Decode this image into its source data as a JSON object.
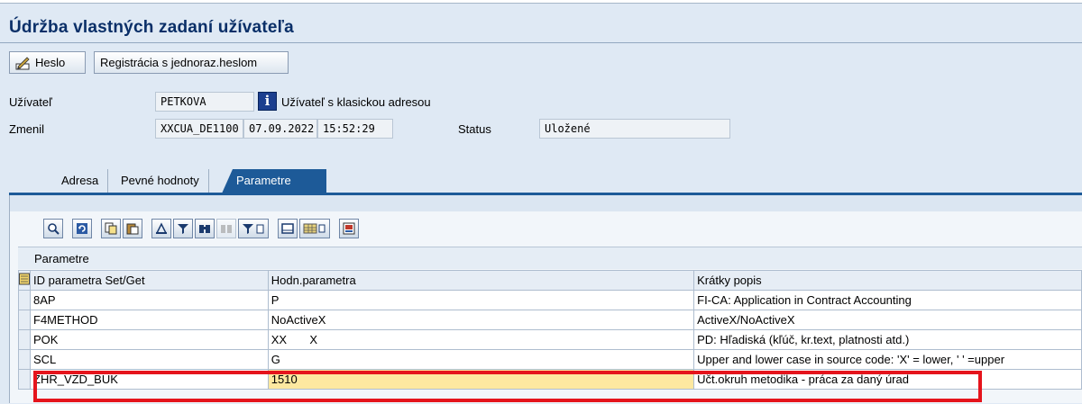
{
  "page": {
    "title": "Údržba vlastných zadaní užívateľa"
  },
  "toolbar": {
    "password_label": "Heslo",
    "one_time_label": "Registrácia s jednoraz.heslom"
  },
  "header_fields": {
    "user_label": "Užívateľ",
    "user_value": "PETKOVA",
    "user_type_text": "Užívateľ s klasickou adresou",
    "changed_label": "Zmenil",
    "changed_by": "XXCUA_DE1100",
    "changed_date": "07.09.2022",
    "changed_time": "15:52:29",
    "status_label": "Status",
    "status_value": "Uložené"
  },
  "tabs": [
    {
      "label": "Adresa",
      "active": false
    },
    {
      "label": "Pevné hodnoty",
      "active": false
    },
    {
      "label": "Parametre",
      "active": true
    }
  ],
  "grid": {
    "caption": "Parametre",
    "columns": [
      "ID parametra Set/Get",
      "Hodn.parametra",
      "Krátky popis"
    ],
    "rows": [
      {
        "id": "8AP",
        "value": "P",
        "desc": "FI-CA: Application in Contract Accounting"
      },
      {
        "id": "F4METHOD",
        "value": "NoActiveX",
        "desc": "ActiveX/NoActiveX"
      },
      {
        "id": "POK",
        "value": "XX       X",
        "desc": "PD: Hľadiská (kľúč, kr.text, platnosti atd.)"
      },
      {
        "id": "SCL",
        "value": "G",
        "desc": "Upper and lower case in source code: 'X' = lower, ' ' =upper"
      },
      {
        "id": "ZHR_VZD_BUK",
        "value": "1510",
        "desc": "Účt.okruh metodika - práca za daný úrad"
      }
    ]
  },
  "colors": {
    "title": "#0a2f68",
    "tab_active": "#1d5a98",
    "highlight_value": "#fde8a0",
    "annotation_box": "#e5141c"
  },
  "icons": [
    "pen-signature-icon",
    "info-icon",
    "details-icon",
    "refresh-icon",
    "copy-icon",
    "paste-icon",
    "print-icon",
    "filter-icon",
    "find-icon",
    "find-next-icon",
    "set-filter-icon",
    "export-icon",
    "layout-icon",
    "spreadsheet-icon",
    "excel-icon",
    "select-all-icon"
  ]
}
